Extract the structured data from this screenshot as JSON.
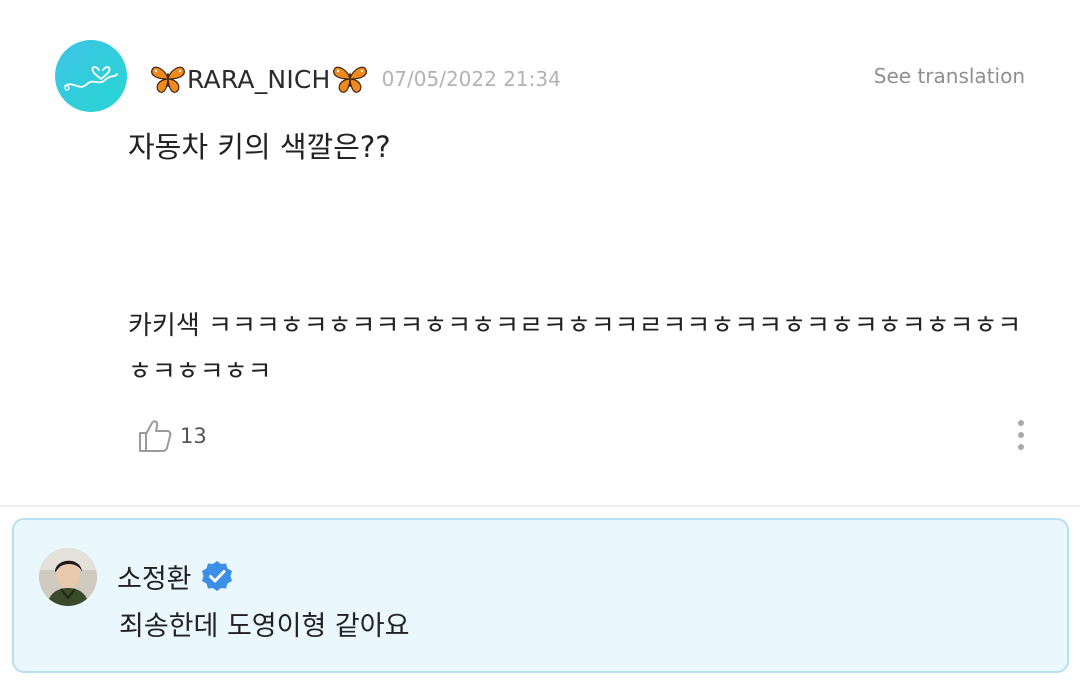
{
  "post": {
    "avatar_icon": "heart-doodle-icon",
    "username": "RARA_NICH",
    "username_emoji_icon": "butterfly-icon",
    "timestamp": "07/05/2022 21:34",
    "see_translation_label": "See translation",
    "text_line1": "자동차 키의 색깔은??",
    "text_line2": "카키색 ㅋㅋㅋㅎㅋㅎㅋㅋㅋㅎㅋㅎㅋㄹㅋㅎㅋㅋㄹㅋㅋㅎㅋㅋㅎㅋㅎㅋㅎㅋㅎㅋㅎㅋㅎㅋㅎㅋㅎㅋ",
    "like_icon": "thumbs-up-icon",
    "like_count": "13",
    "more_icon": "more-vertical-icon"
  },
  "reply": {
    "avatar_icon": "user-photo-avatar",
    "name": "소정환",
    "verified_icon": "verified-badge-icon",
    "text": "죄송한데 도영이형 같아요"
  },
  "colors": {
    "reply_background": "#eaf8fe",
    "reply_border": "#b7e0f0",
    "verified_badge": "#3b8fe8",
    "avatar_gradient_start": "#3ec3e6",
    "avatar_gradient_end": "#27d6d2",
    "timestamp": "#b3b3b3",
    "see_translation": "#8f8f8f"
  }
}
